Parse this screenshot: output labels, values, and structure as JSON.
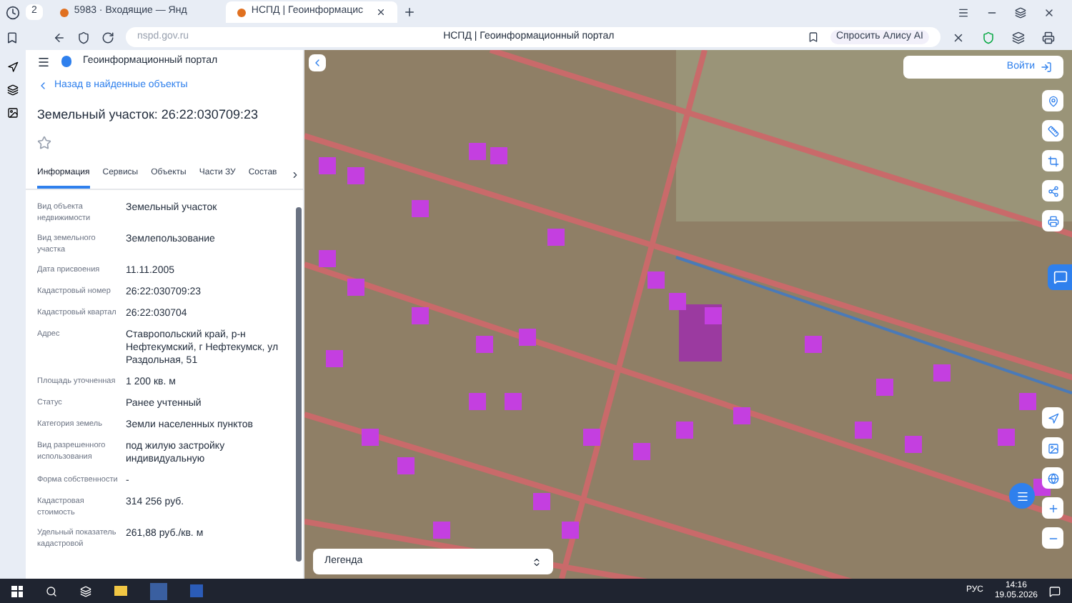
{
  "browser": {
    "tab_count": "2",
    "tabs": [
      {
        "label": "5983 · Входящие — Янд",
        "selected": false
      },
      {
        "label": "НСПД | Геоинформацис",
        "selected": true
      }
    ],
    "address": "nspd.gov.ru",
    "page_title": "НСПД | Геоинформационный портал",
    "assistant": "Спросить Алису AI"
  },
  "panel": {
    "portal_title": "Геоинформационный портал",
    "back_link": "Назад в найденные объекты",
    "title": "Земельный участок: 26:22:030709:23",
    "favorite": false,
    "tabs": [
      {
        "label": "Информация",
        "selected": true
      },
      {
        "label": "Сервисы",
        "selected": false
      },
      {
        "label": "Объекты",
        "selected": false
      },
      {
        "label": "Части ЗУ",
        "selected": false
      },
      {
        "label": "Состав",
        "selected": false
      }
    ],
    "fields": [
      {
        "label": "Вид объекта недвижимости",
        "value": "Земельный участок"
      },
      {
        "label": "Вид земельного участка",
        "value": "Землепользование"
      },
      {
        "label": "Дата присвоения",
        "value": "11.11.2005"
      },
      {
        "label": "Кадастровый номер",
        "value": "26:22:030709:23"
      },
      {
        "label": "Кадастровый квартал",
        "value": "26:22:030704"
      },
      {
        "label": "Адрес",
        "value": "Ставропольский край, р-н Нефтекумский, г Нефтекумск, ул Раздольная, 51"
      },
      {
        "label": "Площадь уточненная",
        "value": "1 200 кв. м"
      },
      {
        "label": "Статус",
        "value": "Ранее учтенный"
      },
      {
        "label": "Категория земель",
        "value": "Земли населенных пунктов"
      },
      {
        "label": "Вид разрешенного использования",
        "value": "под жилую застройку индивидуальную"
      },
      {
        "label": "Форма собственности",
        "value": "-"
      },
      {
        "label": "Кадастровая стоимость",
        "value": "314 256 руб."
      },
      {
        "label": "Удельный показатель кадастровой",
        "value": "261,88 руб./кв. м"
      }
    ]
  },
  "map": {
    "login": "Войти",
    "legend": "Легенда"
  },
  "taskbar": {
    "language": "РУС",
    "time": "14:16",
    "date": "19.05.2026"
  }
}
